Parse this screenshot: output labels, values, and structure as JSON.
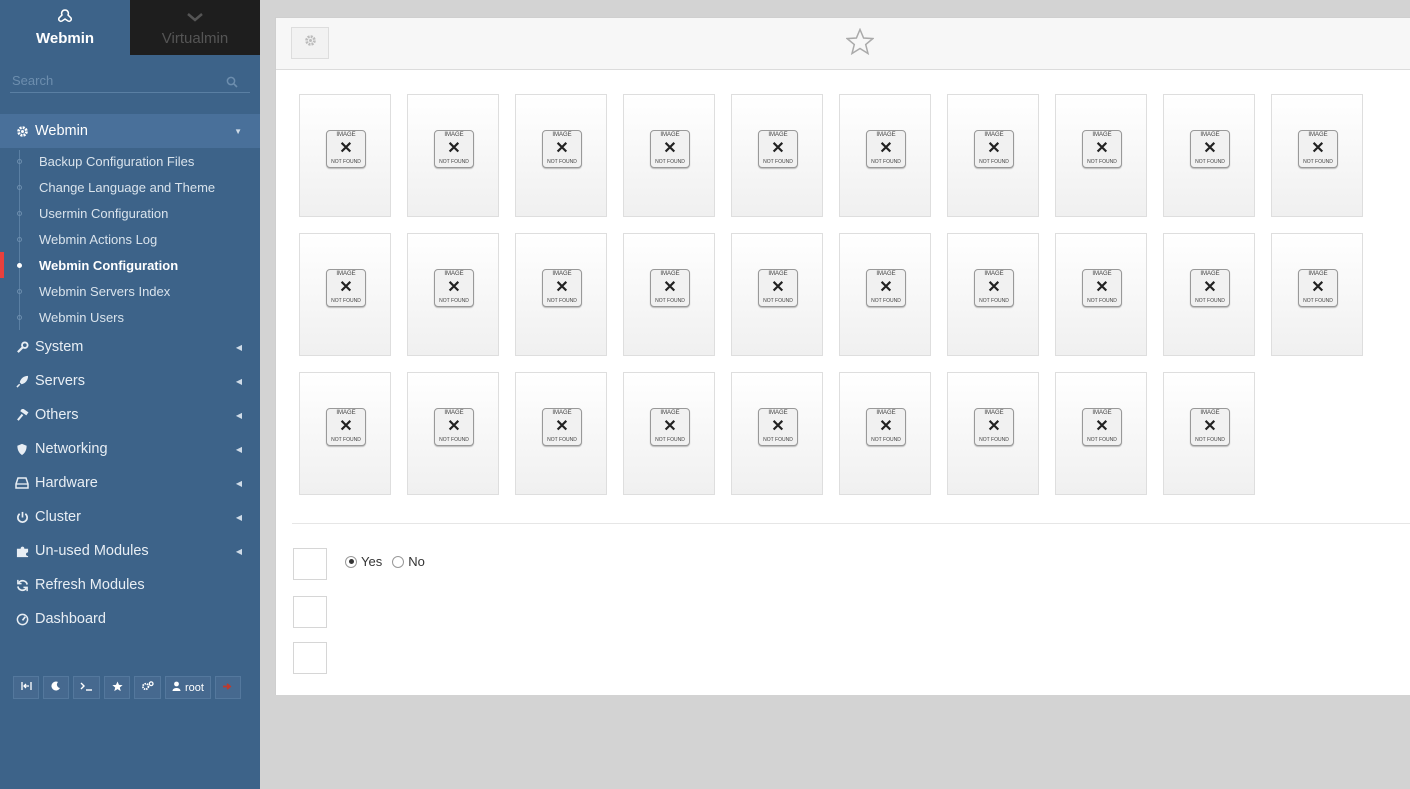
{
  "tabs": {
    "webmin": "Webmin",
    "virtualmin": "Virtualmin"
  },
  "search": {
    "placeholder": "Search"
  },
  "menu": {
    "webmin": "Webmin",
    "webmin_items": [
      "Backup Configuration Files",
      "Change Language and Theme",
      "Usermin Configuration",
      "Webmin Actions Log",
      "Webmin Configuration",
      "Webmin Servers Index",
      "Webmin Users"
    ],
    "active_item": "Webmin Configuration",
    "system": "System",
    "servers": "Servers",
    "others": "Others",
    "networking": "Networking",
    "hardware": "Hardware",
    "cluster": "Cluster",
    "unused": "Un-used Modules",
    "refresh": "Refresh Modules",
    "dashboard": "Dashboard"
  },
  "bottom_bar": {
    "user": "root"
  },
  "tile_placeholder": {
    "line1": "IMAGE",
    "line2": "NOT FOUND"
  },
  "tiles_count": 29,
  "form": {
    "yes": "Yes",
    "no": "No",
    "selected": "Yes"
  },
  "colors": {
    "sidebar": "#3d6389",
    "active_bar": "#e8403d",
    "background": "#d3d3d3"
  }
}
